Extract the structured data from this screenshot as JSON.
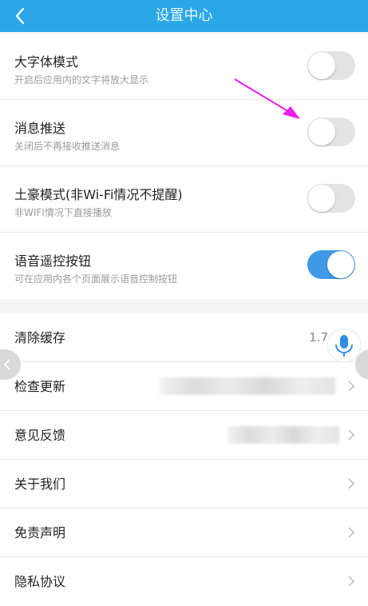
{
  "header": {
    "title": "设置中心",
    "back_icon": "back-arrow-icon",
    "color": "#2aa7e6"
  },
  "toggles": [
    {
      "label": "大字体模式",
      "desc": "开启后应用内的文字将放大显示",
      "on": false
    },
    {
      "label": "消息推送",
      "desc": "关闭后不再接收推送消息",
      "on": false
    },
    {
      "label": "土豪模式(非Wi-Fi情况不提醒)",
      "desc": "非WIFI情况下直接播放",
      "on": false
    },
    {
      "label": "语音遥控按钮",
      "desc": "可在应用内各个页面展示语音控制按钮",
      "on": true
    }
  ],
  "list": {
    "clear_cache": {
      "label": "清除缓存",
      "value": "1.7"
    },
    "check_update": {
      "label": "检查更新"
    },
    "feedback": {
      "label": "意见反馈"
    },
    "about": {
      "label": "关于我们"
    },
    "disclaimer": {
      "label": "免责声明"
    },
    "privacy": {
      "label": "隐私协议"
    }
  },
  "colors": {
    "toggle_on": "#3e9ae6",
    "toggle_off": "#e3e3e3",
    "annotation_arrow": "#e91ee8"
  },
  "icons": {
    "mic": "microphone-icon",
    "chevron": "chevron-right-icon"
  }
}
